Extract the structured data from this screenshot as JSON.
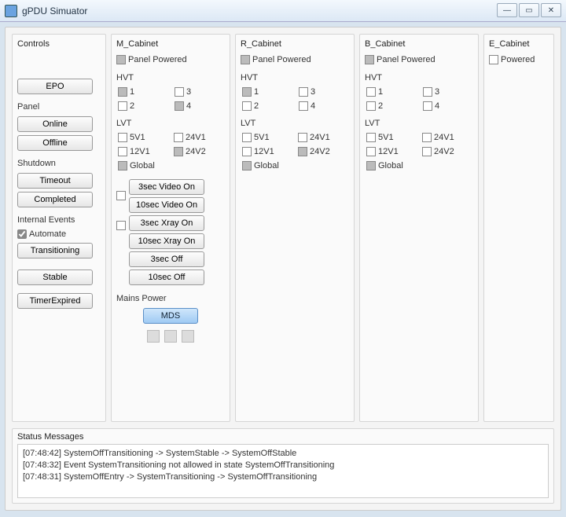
{
  "window": {
    "title": "gPDU Simuator"
  },
  "controls": {
    "header": "Controls",
    "epo": "EPO",
    "panel_label": "Panel",
    "online": "Online",
    "offline": "Offline",
    "shutdown_label": "Shutdown",
    "timeout": "Timeout",
    "completed": "Completed",
    "internal_label": "Internal Events",
    "automate": "Automate",
    "transitioning": "Transitioning",
    "stable": "Stable",
    "timerexpired": "TimerExpired"
  },
  "m": {
    "header": "M_Cabinet",
    "panel_powered": "Panel Powered",
    "hvt_label": "HVT",
    "hvt": {
      "cb1": "1",
      "cb2": "2",
      "cb3": "3",
      "cb4": "4"
    },
    "lvt_label": "LVT",
    "lvt": {
      "v5v1": "5V1",
      "v12v1": "12V1",
      "v24v1": "24V1",
      "v24v2": "24V2",
      "global": "Global"
    },
    "btns": {
      "v3on": "3sec Video On",
      "v10on": "10sec Video On",
      "x3on": "3sec Xray On",
      "x10on": "10sec Xray On",
      "off3": "3sec Off",
      "off10": "10sec Off"
    },
    "mains_label": "Mains Power",
    "mds": "MDS"
  },
  "r": {
    "header": "R_Cabinet",
    "panel_powered": "Panel Powered",
    "hvt_label": "HVT",
    "hvt": {
      "cb1": "1",
      "cb2": "2",
      "cb3": "3",
      "cb4": "4"
    },
    "lvt_label": "LVT",
    "lvt": {
      "v5v1": "5V1",
      "v12v1": "12V1",
      "v24v1": "24V1",
      "v24v2": "24V2",
      "global": "Global"
    }
  },
  "b": {
    "header": "B_Cabinet",
    "panel_powered": "Panel Powered",
    "hvt_label": "HVT",
    "hvt": {
      "cb1": "1",
      "cb2": "2",
      "cb3": "3",
      "cb4": "4"
    },
    "lvt_label": "LVT",
    "lvt": {
      "v5v1": "5V1",
      "v12v1": "12V1",
      "v24v1": "24V1",
      "v24v2": "24V2",
      "global": "Global"
    }
  },
  "e": {
    "header": "E_Cabinet",
    "powered": "Powered"
  },
  "status": {
    "header": "Status Messages",
    "lines": [
      "[07:48:42] SystemOffTransitioning -> SystemStable -> SystemOffStable",
      "[07:48:32] Event SystemTransitioning not allowed in state SystemOffTransitioning",
      "[07:48:31] SystemOffEntry -> SystemTransitioning -> SystemOffTransitioning"
    ]
  }
}
